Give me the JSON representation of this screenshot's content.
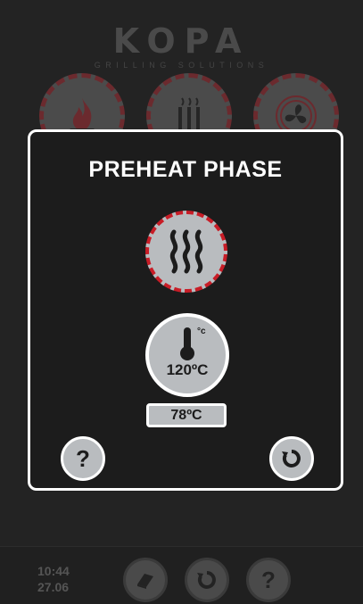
{
  "brand": {
    "name": "KOPA",
    "tagline": "GRILLING SOLUTIONS"
  },
  "top_buttons": [
    {
      "icon": "flame-icon"
    },
    {
      "icon": "heating-element-icon"
    },
    {
      "icon": "fan-icon"
    }
  ],
  "modal": {
    "title": "PREHEAT PHASE",
    "phase_icon": "heat-waves-icon",
    "unit_symbol": "°c",
    "set_temperature": "120ºC",
    "current_temperature": "78ºC",
    "help_label": "?",
    "accent_color": "#c81d27"
  },
  "status_bar": {
    "time": "10:44",
    "date": "27.06",
    "help_label": "?"
  },
  "colors": {
    "background": "#1c1c1c",
    "button_fill": "#b9bcbf",
    "accent": "#c81d27"
  }
}
